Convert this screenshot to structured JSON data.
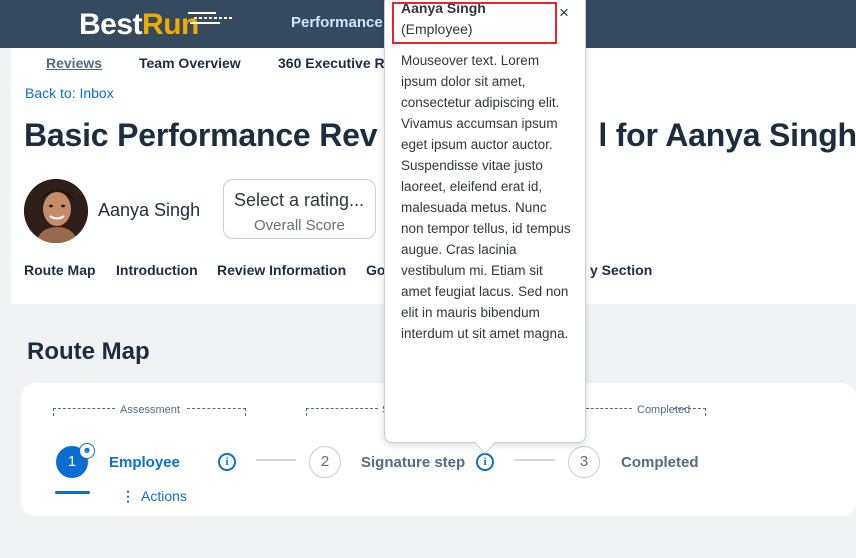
{
  "shell": {
    "logo_best": "Best",
    "logo_run": "Run",
    "nav_title": "Performance"
  },
  "tabs": [
    {
      "label": "Reviews"
    },
    {
      "label": "Team Overview"
    },
    {
      "label": "360 Executive R"
    }
  ],
  "page": {
    "back_link": "Back to: Inbox",
    "title": "Basic Performance Rev",
    "title_tail": "l for Aanya Singh",
    "employee_name": "Aanya Singh",
    "rating_value": "Select a rating...",
    "rating_label": "Overall Score"
  },
  "anchors": [
    {
      "label": "Route Map"
    },
    {
      "label": "Introduction"
    },
    {
      "label": "Review Information"
    },
    {
      "label": "Go"
    },
    {
      "label": "y Section"
    }
  ],
  "route_map": {
    "title": "Route Map",
    "groups": [
      {
        "label": "Assessment"
      },
      {
        "label": "S"
      },
      {
        "label": "Completed"
      }
    ],
    "steps": [
      {
        "number": "1",
        "label": "Employee"
      },
      {
        "number": "2",
        "label": "Signature step"
      },
      {
        "number": "3",
        "label": "Completed"
      }
    ],
    "actions_label": "Actions"
  },
  "popover": {
    "name": "Aanya Singh",
    "role": "(Employee)",
    "close": "×",
    "body": "Mouseover text. Lorem ipsum dolor sit amet, consectetur adipiscing elit. Vivamus accumsan ipsum eget ipsum auctor auctor. Suspendisse vitae justo laoreet, eleifend erat id, malesuada metus. Nunc non tempor tellus, id tempus augue. Cras lacinia vestibulum mi. Etiam sit amet feugiat lacus. Sed non elit in mauris bibendum interdum ut sit amet magna."
  },
  "colors": {
    "shell": "#354a5f",
    "accent": "#0a6ed1",
    "logo_run": "#f0ab00",
    "highlight": "#e8262a"
  },
  "icons": [
    "info-icon",
    "close-icon",
    "overflow-icon",
    "person-badge-icon"
  ]
}
